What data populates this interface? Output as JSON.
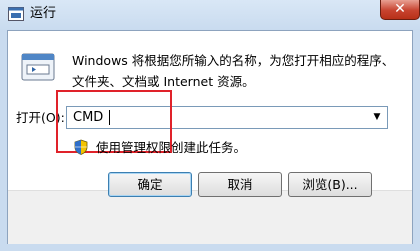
{
  "window": {
    "title": "运行",
    "close_glyph": "✕"
  },
  "description": "Windows 将根据您所输入的名称，为您打开相应的程序、文件夹、文档或 Internet 资源。",
  "open_field": {
    "label": "打开(O):",
    "value": "CMD"
  },
  "admin_note": "使用管理权限创建此任务。",
  "buttons": {
    "ok": "确定",
    "cancel": "取消",
    "browse": "浏览(B)..."
  },
  "icons": [
    "run-icon",
    "shield-icon",
    "dropdown-arrow-icon",
    "close-icon"
  ]
}
